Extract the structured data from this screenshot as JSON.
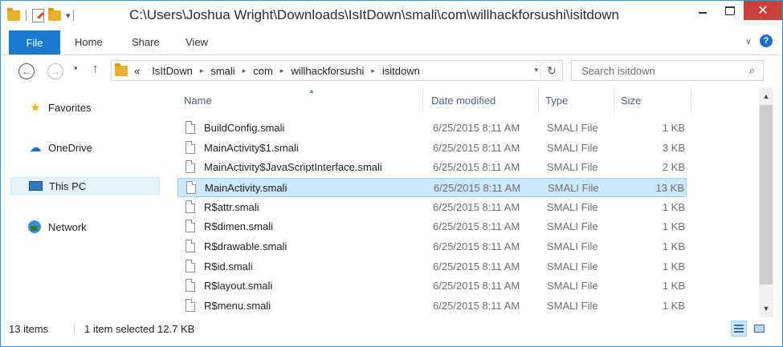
{
  "window": {
    "title": "C:\\Users\\Joshua Wright\\Downloads\\IsItDown\\smali\\com\\willhackforsushi\\isitdown",
    "controls": {
      "minimize": "minimize-icon",
      "maximize": "maximize-icon",
      "close": "✕"
    }
  },
  "quick_access": {
    "customize_arrow": "▾"
  },
  "ribbon": {
    "file_tab": "File",
    "tabs": [
      "Home",
      "Share",
      "View"
    ],
    "expand_icon": "chevron-down-icon",
    "help_label": "?"
  },
  "nav": {
    "back": "←",
    "forward": "→",
    "recent": "▾",
    "up": "↑",
    "breadcrumb_prefix": "«",
    "breadcrumbs": [
      "IsItDown",
      "smali",
      "com",
      "willhackforsushi",
      "isitdown"
    ],
    "breadcrumb_sep": "▸",
    "dropdown": "▾",
    "refresh": "↻"
  },
  "search": {
    "placeholder": "Search isitdown",
    "icon": "⌕"
  },
  "navpane": {
    "items": [
      {
        "label": "Favorites",
        "icon": "star-icon"
      },
      {
        "label": "OneDrive",
        "icon": "onedrive-icon"
      },
      {
        "label": "This PC",
        "icon": "computer-icon",
        "selected": true
      },
      {
        "label": "Network",
        "icon": "network-icon"
      }
    ]
  },
  "filelist": {
    "columns": [
      "Name",
      "Date modified",
      "Type",
      "Size"
    ],
    "sort_indicator": "▲",
    "rows": [
      {
        "name": "BuildConfig.smali",
        "date": "6/25/2015 8:11 AM",
        "type": "SMALI File",
        "size": "1 KB"
      },
      {
        "name": "MainActivity$1.smali",
        "date": "6/25/2015 8:11 AM",
        "type": "SMALI File",
        "size": "3 KB"
      },
      {
        "name": "MainActivity$JavaScriptInterface.smali",
        "date": "6/25/2015 8:11 AM",
        "type": "SMALI File",
        "size": "2 KB"
      },
      {
        "name": "MainActivity.smali",
        "date": "6/25/2015 8:11 AM",
        "type": "SMALI File",
        "size": "13 KB",
        "selected": true
      },
      {
        "name": "R$attr.smali",
        "date": "6/25/2015 8:11 AM",
        "type": "SMALI File",
        "size": "1 KB"
      },
      {
        "name": "R$dimen.smali",
        "date": "6/25/2015 8:11 AM",
        "type": "SMALI File",
        "size": "1 KB"
      },
      {
        "name": "R$drawable.smali",
        "date": "6/25/2015 8:11 AM",
        "type": "SMALI File",
        "size": "1 KB"
      },
      {
        "name": "R$id.smali",
        "date": "6/25/2015 8:11 AM",
        "type": "SMALI File",
        "size": "1 KB"
      },
      {
        "name": "R$layout.smali",
        "date": "6/25/2015 8:11 AM",
        "type": "SMALI File",
        "size": "1 KB"
      },
      {
        "name": "R$menu.smali",
        "date": "6/25/2015 8:11 AM",
        "type": "SMALI File",
        "size": "1 KB"
      }
    ]
  },
  "scrollbar": {
    "up": "▲",
    "down": "▼"
  },
  "status": {
    "item_count": "13 items",
    "selection": "1 item selected  12.7 KB",
    "views": [
      "details-view-icon",
      "large-icons-view-icon"
    ]
  },
  "colors": {
    "accent": "#1979ca",
    "close_button": "#c7413b",
    "selection_bg": "#cce8ff",
    "selection_border": "#99d1ff"
  }
}
